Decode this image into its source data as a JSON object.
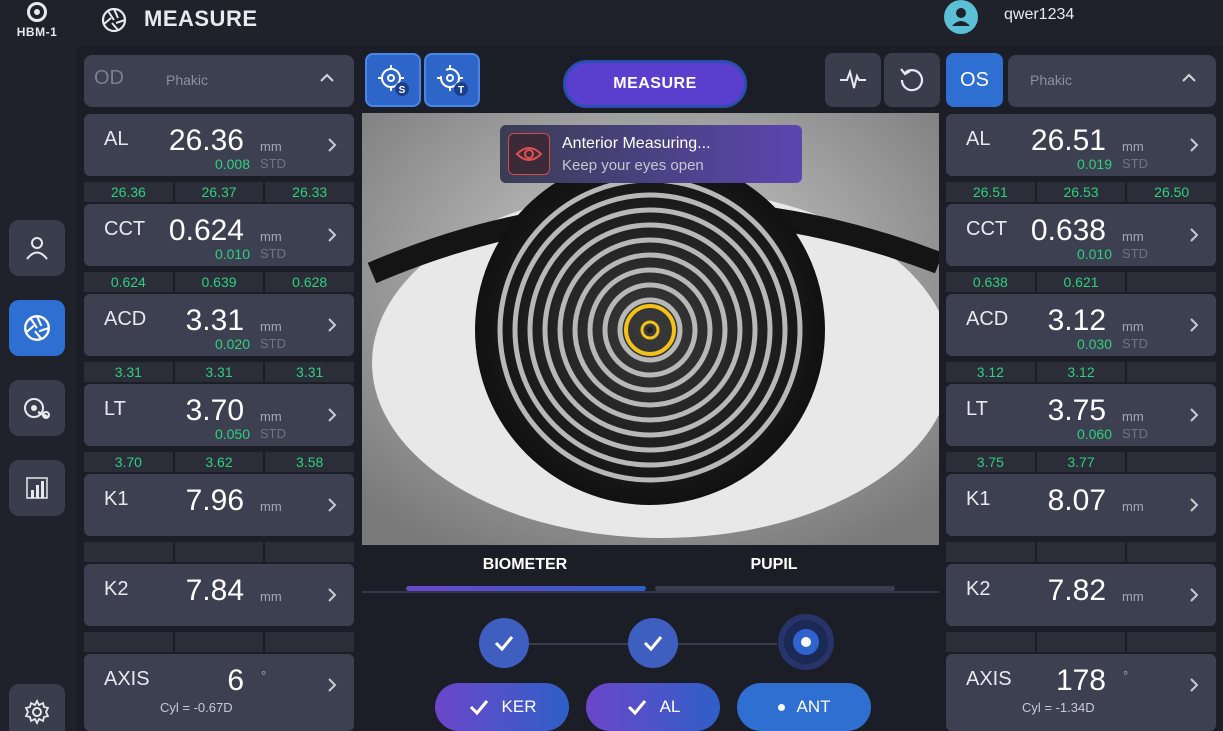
{
  "header": {
    "device_label": "HBM-1",
    "title": "MEASURE",
    "username": "qwer1234"
  },
  "sidebar": {
    "items": [
      {
        "name": "patient",
        "icon": "user-icon"
      },
      {
        "name": "measure",
        "icon": "aperture-icon",
        "active": true
      },
      {
        "name": "review",
        "icon": "eye-scan-icon"
      },
      {
        "name": "analysis",
        "icon": "bar-chart-icon"
      },
      {
        "name": "settings",
        "icon": "gear-icon"
      }
    ]
  },
  "od": {
    "side": "OD",
    "lens": "Phakic",
    "cards": {
      "al": {
        "label": "AL",
        "value": "26.36",
        "unit": "mm",
        "std": "0.008",
        "std_label": "STD",
        "readings": [
          "26.36",
          "26.37",
          "26.33"
        ]
      },
      "cct": {
        "label": "CCT",
        "value": "0.624",
        "unit": "mm",
        "std": "0.010",
        "std_label": "STD",
        "readings": [
          "0.624",
          "0.639",
          "0.628"
        ]
      },
      "acd": {
        "label": "ACD",
        "value": "3.31",
        "unit": "mm",
        "std": "0.020",
        "std_label": "STD",
        "readings": [
          "3.31",
          "3.31",
          "3.31"
        ]
      },
      "lt": {
        "label": "LT",
        "value": "3.70",
        "unit": "mm",
        "std": "0.050",
        "std_label": "STD",
        "readings": [
          "3.70",
          "3.62",
          "3.58"
        ]
      },
      "k1": {
        "label": "K1",
        "value": "7.96",
        "unit": "mm"
      },
      "k2": {
        "label": "K2",
        "value": "7.84",
        "unit": "mm"
      },
      "axis": {
        "label": "AXIS",
        "value": "6",
        "unit": "°",
        "cyl": "Cyl = -0.67D"
      }
    }
  },
  "os": {
    "side": "OS",
    "lens": "Phakic",
    "cards": {
      "al": {
        "label": "AL",
        "value": "26.51",
        "unit": "mm",
        "std": "0.019",
        "std_label": "STD",
        "readings": [
          "26.51",
          "26.53",
          "26.50"
        ]
      },
      "cct": {
        "label": "CCT",
        "value": "0.638",
        "unit": "mm",
        "std": "0.010",
        "std_label": "STD",
        "readings": [
          "0.638",
          "0.621",
          ""
        ]
      },
      "acd": {
        "label": "ACD",
        "value": "3.12",
        "unit": "mm",
        "std": "0.030",
        "std_label": "STD",
        "readings": [
          "3.12",
          "3.12",
          ""
        ]
      },
      "lt": {
        "label": "LT",
        "value": "3.75",
        "unit": "mm",
        "std": "0.060",
        "std_label": "STD",
        "readings": [
          "3.75",
          "3.77",
          ""
        ]
      },
      "k1": {
        "label": "K1",
        "value": "8.07",
        "unit": "mm"
      },
      "k2": {
        "label": "K2",
        "value": "7.82",
        "unit": "mm"
      },
      "axis": {
        "label": "AXIS",
        "value": "178",
        "unit": "°",
        "cyl": "Cyl = -1.34D"
      }
    }
  },
  "toolbar": {
    "target_s_badge": "S",
    "target_t_badge": "T",
    "measure_label": "MEASURE"
  },
  "toast": {
    "title": "Anterior Measuring...",
    "subtitle": "Keep your eyes open"
  },
  "tabs": [
    {
      "label": "BIOMETER",
      "active": true
    },
    {
      "label": "PUPIL",
      "active": false
    }
  ],
  "steps": [
    {
      "label": "KER",
      "state": "done"
    },
    {
      "label": "AL",
      "state": "done"
    },
    {
      "label": "ANT",
      "state": "current"
    }
  ],
  "colors": {
    "accent_blue": "#2f6fd2",
    "value_green": "#2fd07f",
    "measure_purple": "#5a3fcf",
    "target_yellow": "#f2c21a"
  }
}
